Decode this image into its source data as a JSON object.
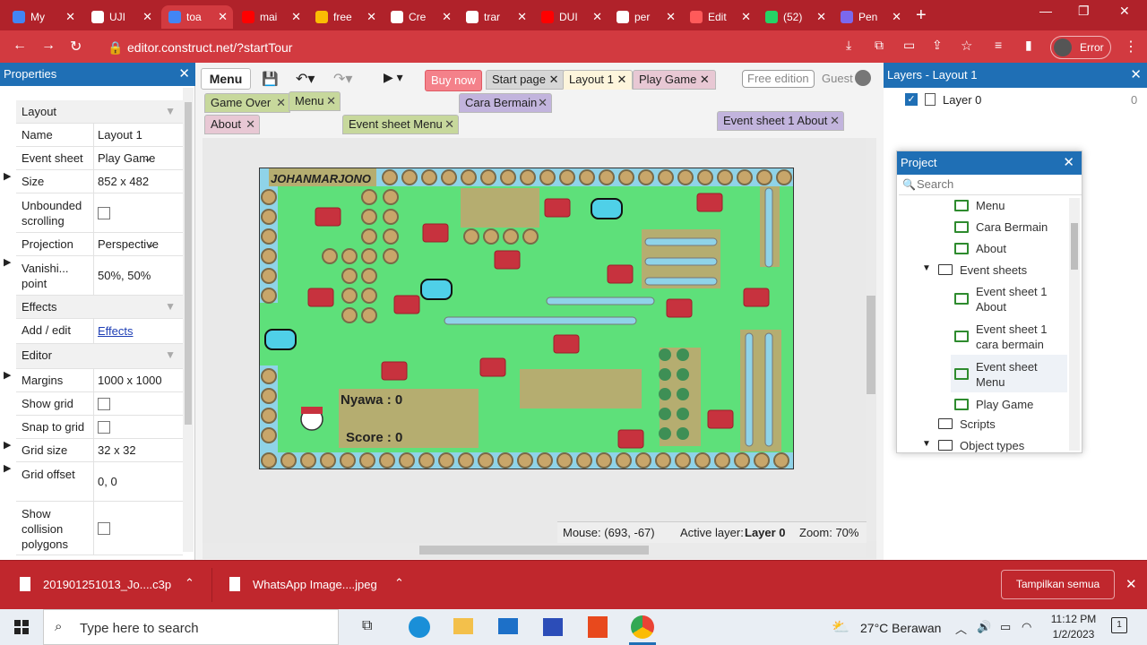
{
  "browser": {
    "tabs": [
      {
        "label": "My",
        "color": "#4285f4"
      },
      {
        "label": "UJI",
        "color": "#ffffff"
      },
      {
        "label": "toa",
        "color": "#4285f4"
      },
      {
        "label": "mai",
        "color": "#ff0000"
      },
      {
        "label": "free",
        "color": "#fbbc04"
      },
      {
        "label": "Cre",
        "color": "#ffffff"
      },
      {
        "label": "trar",
        "color": "#ffffff"
      },
      {
        "label": "DUI",
        "color": "#ff0000"
      },
      {
        "label": "per",
        "color": "#ffffff"
      },
      {
        "label": "Edit",
        "color": "#ff5a5a"
      },
      {
        "label": "(52)",
        "color": "#25d366"
      },
      {
        "label": "Pen",
        "color": "#7b68ee"
      }
    ],
    "url": "editor.construct.net/?startTour",
    "profile": "Error"
  },
  "toolbar": {
    "menu": "Menu",
    "buy_now": "Buy now",
    "start_page": "Start page",
    "layout1": "Layout 1",
    "play_game": "Play Game",
    "free_edition": "Free edition",
    "guest": "Guest"
  },
  "editor_tabs": [
    "Game Over",
    "Menu",
    "Event sheet Menu",
    "Cara Bermain",
    "Event sheet 1 cara bermain",
    "Event sheet 1 About",
    "About"
  ],
  "properties": {
    "title": "Properties",
    "rows": [
      {
        "label": "Layout",
        "section": true
      },
      {
        "label": "Name",
        "value": "Layout 1"
      },
      {
        "label": "Event sheet",
        "value": "Play Game"
      },
      {
        "label": "Size",
        "value": "852 x 482"
      },
      {
        "label": "Unbounded scrolling",
        "value": ""
      },
      {
        "label": "Projection",
        "value": "Perspective"
      },
      {
        "label": "Vanishi... point",
        "value": "50%, 50%"
      },
      {
        "label": "Effects",
        "section": true
      },
      {
        "label": "Add / edit",
        "value": "Effects"
      },
      {
        "label": "Editor",
        "section": true
      },
      {
        "label": "Margins",
        "value": "1000 x 1000"
      },
      {
        "label": "Show grid",
        "value": ""
      },
      {
        "label": "Snap to grid",
        "value": ""
      },
      {
        "label": "Grid size",
        "value": "32 x 32"
      },
      {
        "label": "Grid offset",
        "value": "0, 0"
      },
      {
        "label": "Show collision polygons",
        "value": ""
      }
    ]
  },
  "game": {
    "title": "JOHANMARJONO",
    "nyawa": "Nyawa : 0",
    "score": "Score : 0"
  },
  "status": {
    "mouse": "Mouse: (693, -67)",
    "active_layer_label": "Active layer:",
    "active_layer": "Layer 0",
    "zoom": "Zoom: 70%"
  },
  "layers": {
    "title": "Layers - Layout 1",
    "layer": "Layer 0",
    "count": "0"
  },
  "project": {
    "title": "Project",
    "search_placeholder": "Search",
    "items": [
      "Menu",
      "Cara Bermain",
      "About",
      "Event sheets",
      "Event sheet 1 About",
      "Event sheet 1 cara bermain",
      "Event sheet Menu",
      "Play Game",
      "Scripts",
      "Object types"
    ]
  },
  "downloads": {
    "file1": "201901251013_Jo....c3p",
    "file2": "WhatsApp Image....jpeg",
    "show_all": "Tampilkan semua"
  },
  "taskbar": {
    "search": "Type here to search",
    "weather": "27°C  Berawan",
    "time": "11:12 PM",
    "date": "1/2/2023"
  }
}
